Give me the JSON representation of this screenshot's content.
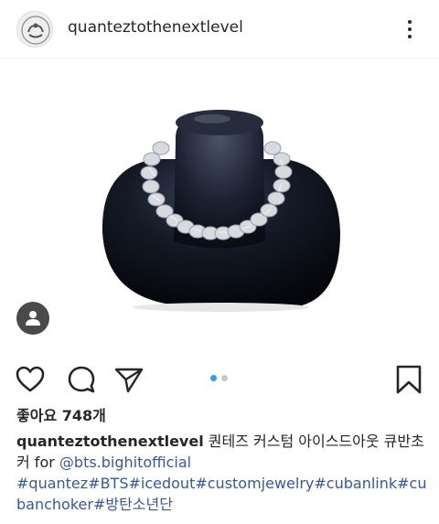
{
  "header": {
    "username": "quanteztothenextlevel",
    "more_icon": "more-vertical-icon"
  },
  "post": {
    "image_description_icon": "necklace-photo",
    "user_tag_icon": "person-icon",
    "carousel": {
      "total": 2,
      "active_index": 0,
      "active_color": "#3897f0",
      "inactive_color": "#c7c7c7"
    }
  },
  "actions": {
    "like_icon": "heart-icon",
    "comment_icon": "comment-icon",
    "share_icon": "paper-plane-icon",
    "save_icon": "bookmark-icon"
  },
  "likes_text": "좋아요 748개",
  "caption": {
    "username": "quanteztothenextlevel",
    "text_1": " 퀀테즈 커스텀 아이스드아웃 큐반초커 for ",
    "mention": "@bts.bighitofficial",
    "hashtags": [
      "#quantez",
      "#BTS",
      "#icedout",
      "#customjewelry",
      "#cubanlink",
      "#cubanchoker",
      "#방탄소년단"
    ]
  },
  "colors": {
    "link": "#385898",
    "text": "#262626"
  }
}
